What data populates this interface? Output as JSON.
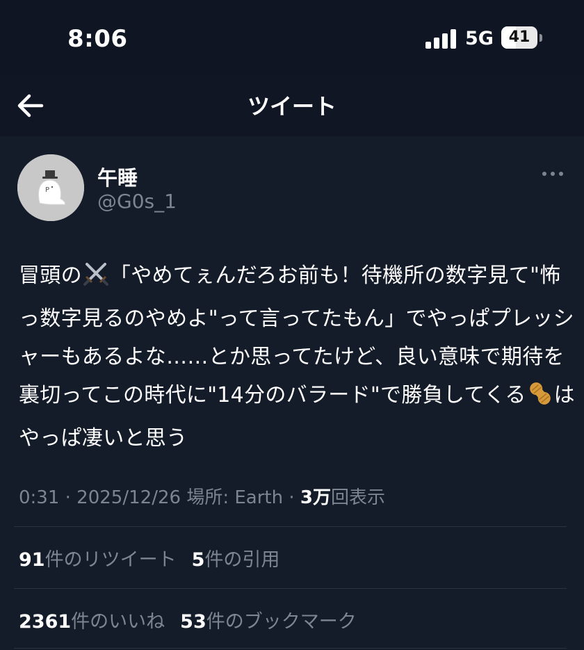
{
  "status_bar": {
    "time": "8:06",
    "network": "5G",
    "battery_level": "41",
    "battery_fraction": 0.41,
    "signal_icon": "cellular-signal-icon"
  },
  "header": {
    "back_icon": "arrow-left-icon",
    "title": "ツイート"
  },
  "author": {
    "display_name": "午睡",
    "handle": "@G0s_1",
    "more_icon": "more-dots-icon"
  },
  "tweet": {
    "text_1": "冒頭の",
    "emoji_1": "crossed-swords-icon",
    "text_2": "「やめてぇんだろお前も！待機所の数字見て\"怖っ数字見るのやめよ\"って言ってたもん」でやっぱプレッシャーもあるよな……とか思ってたけど、良い意味で期待を裏切ってこの時代に\"14分のバラード\"で勝負してくる",
    "emoji_2": "peanut-icon",
    "text_3": "はやっぱ凄いと思う"
  },
  "meta": {
    "timestamp": "0:31 · 2025/12/26",
    "location": "場所: Earth",
    "separator": " · ",
    "views_count": "3万",
    "views_label": "回表示"
  },
  "stats": {
    "retweets_count": "91",
    "retweets_label": "件のリツイート",
    "quotes_count": "5",
    "quotes_label": "件の引用",
    "likes_count": "2361",
    "likes_label": "件のいいね",
    "bookmarks_count": "53",
    "bookmarks_label": "件のブックマーク"
  }
}
